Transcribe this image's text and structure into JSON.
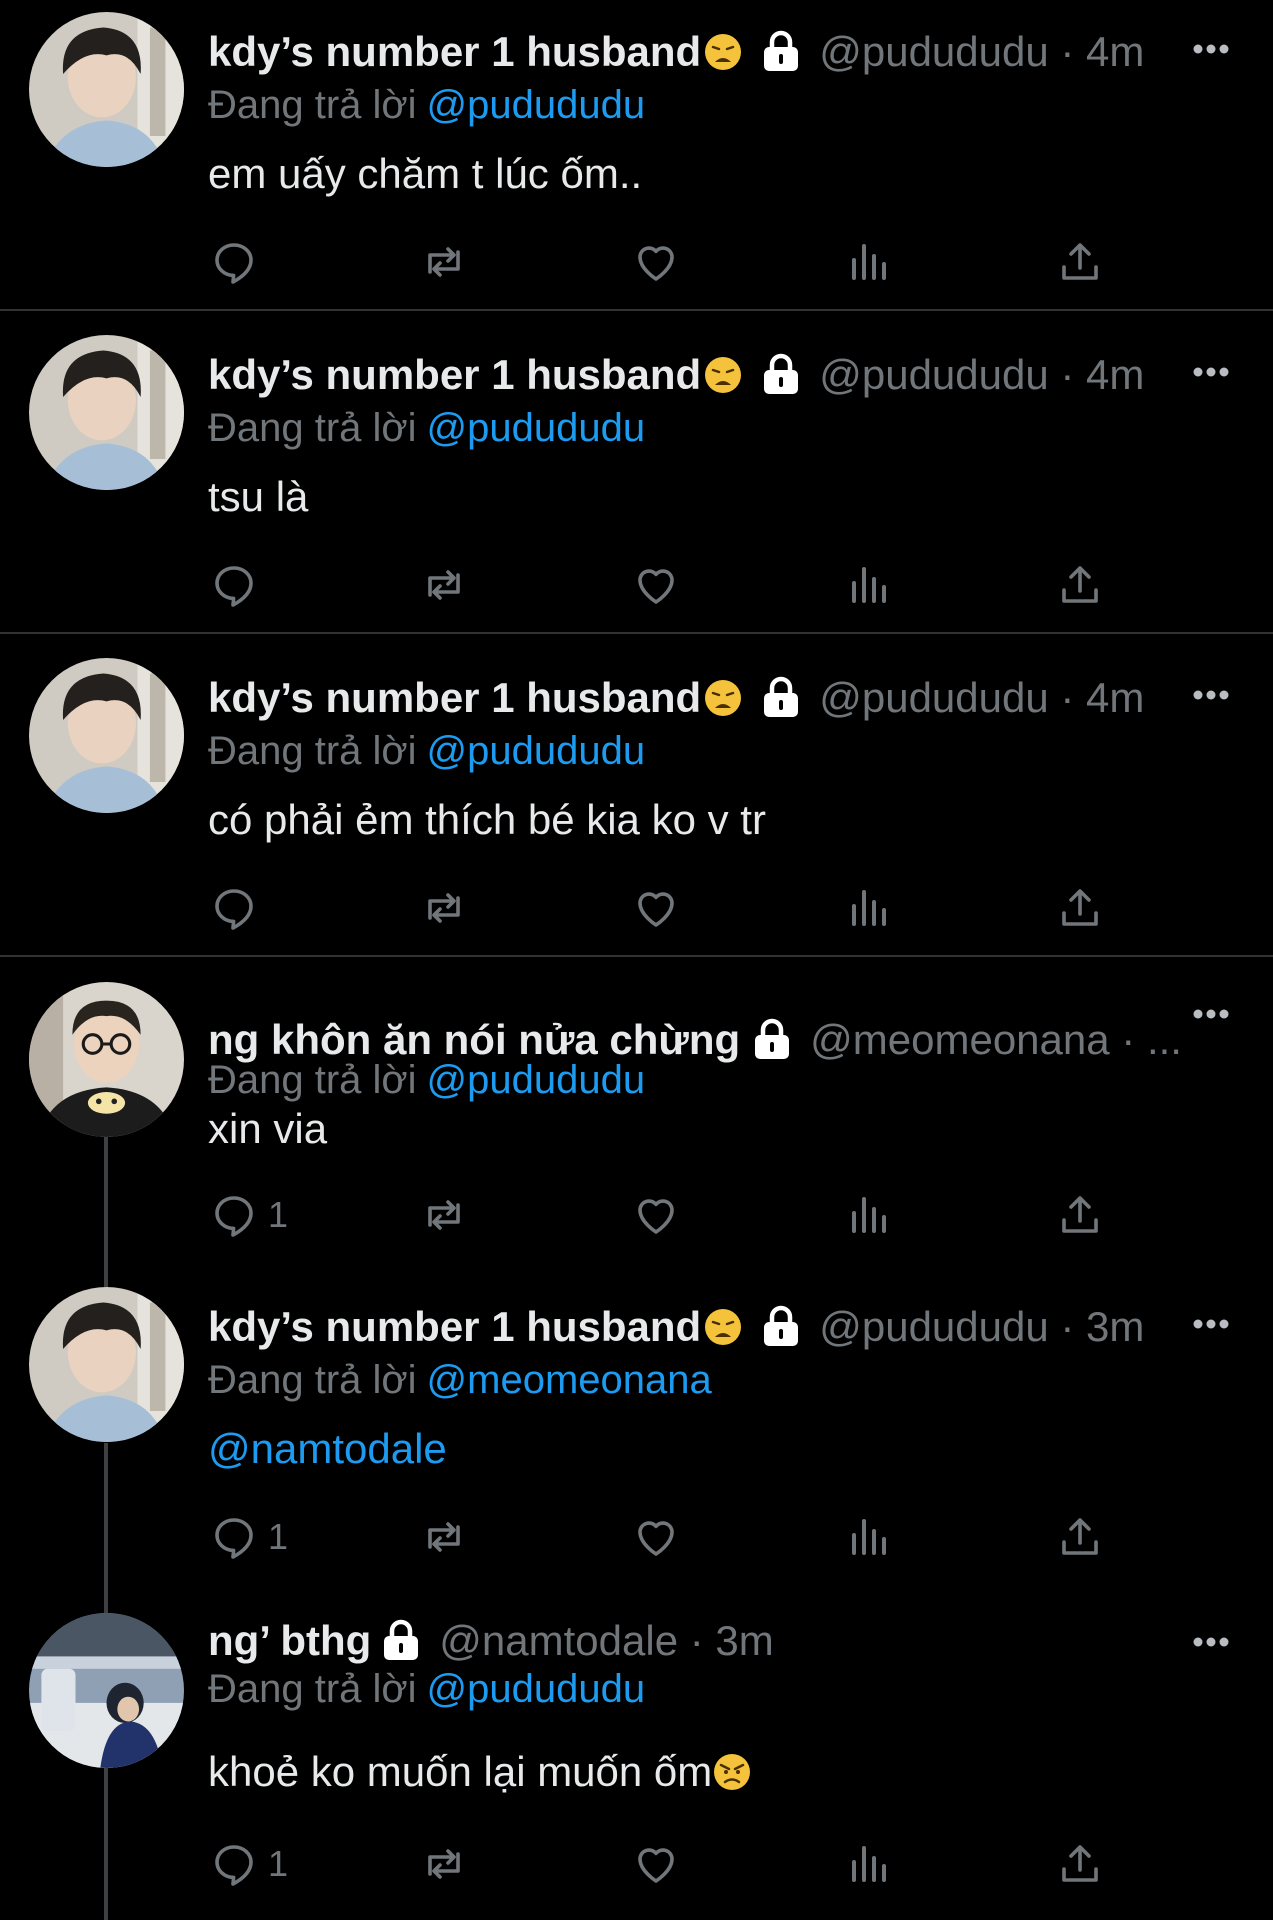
{
  "reply_prefix": "Đang trả lời",
  "colors": {
    "background": "#000000",
    "text": "#e7e9ea",
    "secondary": "#71767b",
    "link": "#1d9bf0",
    "divider": "#2f3336"
  },
  "tweets": [
    {
      "display_name": "kdy’s number 1 husband",
      "name_emoji": "tired-face-emoji",
      "protected": true,
      "handle": "@pudududu",
      "time": "4m",
      "meta": "@pudududu · 4m",
      "replying_to": "@pudududu",
      "text": "em uấy chăm t lúc ốm..",
      "reply_count": "",
      "avatar": "avatar-man-bangs-icon"
    },
    {
      "display_name": "kdy’s number 1 husband",
      "name_emoji": "tired-face-emoji",
      "protected": true,
      "handle": "@pudududu",
      "time": "4m",
      "meta": "@pudududu · 4m",
      "replying_to": "@pudududu",
      "text": "tsu là",
      "reply_count": "",
      "avatar": "avatar-man-bangs-icon"
    },
    {
      "display_name": "kdy’s number 1 husband",
      "name_emoji": "tired-face-emoji",
      "protected": true,
      "handle": "@pudududu",
      "time": "4m",
      "meta": "@pudududu · 4m",
      "replying_to": "@pudududu",
      "text": "có phải ẻm thích bé kia ko v tr",
      "reply_count": "",
      "avatar": "avatar-man-bangs-icon"
    },
    {
      "display_name": "ng khôn ăn nói nửa chừng",
      "name_emoji": "",
      "protected": true,
      "handle": "@meomeonana",
      "time": "",
      "meta": "@meomeonana · ...",
      "replying_to": "@pudududu",
      "text": "xin via",
      "reply_count": "1",
      "avatar": "avatar-man-glasses-icon"
    },
    {
      "display_name": "kdy’s number 1 husband",
      "name_emoji": "tired-face-emoji",
      "protected": true,
      "handle": "@pudududu",
      "time": "3m",
      "meta": "@pudududu · 3m",
      "replying_to": "@meomeonana",
      "text": "@namtodale",
      "reply_count": "1",
      "avatar": "avatar-man-bangs-icon"
    },
    {
      "display_name": "ng’ bthg",
      "name_emoji": "",
      "protected": true,
      "handle": "@namtodale",
      "time": "3m",
      "meta": "@namtodale · 3m",
      "replying_to": "@pudududu",
      "text": "khoẻ ko muốn lại muốn ốm",
      "text_emoji": "angry-face-emoji",
      "reply_count": "1",
      "avatar": "avatar-car-photo-icon"
    }
  ]
}
